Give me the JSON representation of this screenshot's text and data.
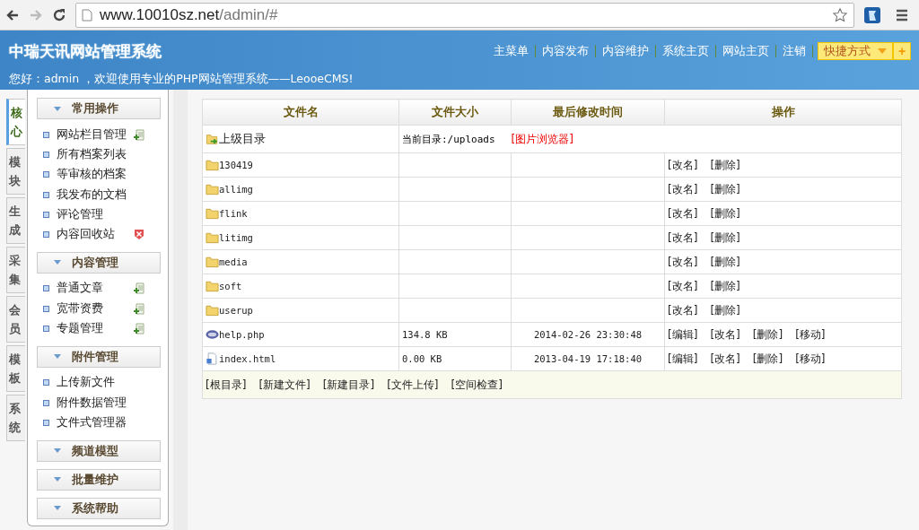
{
  "browser": {
    "url_host": "www.10010sz.net",
    "url_path": "/admin/#"
  },
  "header": {
    "title": "中瑞天讯网站管理系统",
    "welcome": "您好：admin ，欢迎使用专业的PHP网站管理系统——LeooeCMS!",
    "nav": [
      "主菜单",
      "内容发布",
      "内容维护",
      "系统主页",
      "网站主页",
      "注销"
    ],
    "shortcut": {
      "label": "快捷方式",
      "plus": "+"
    }
  },
  "side_tabs": [
    {
      "label": "核心",
      "selected": true
    },
    {
      "label": "模块",
      "selected": false
    },
    {
      "label": "生成",
      "selected": false
    },
    {
      "label": "采集",
      "selected": false
    },
    {
      "label": "会员",
      "selected": false
    },
    {
      "label": "模板",
      "selected": false
    },
    {
      "label": "系统",
      "selected": false
    }
  ],
  "sections": [
    {
      "title": "常用操作",
      "items": [
        {
          "label": "网站栏目管理",
          "kind": "add"
        },
        {
          "label": "所有档案列表",
          "kind": "plain"
        },
        {
          "label": "等审核的档案",
          "kind": "plain"
        },
        {
          "label": "我发布的文档",
          "kind": "plain"
        },
        {
          "label": "评论管理",
          "kind": "plain"
        },
        {
          "label": "内容回收站",
          "kind": "remove"
        }
      ]
    },
    {
      "title": "内容管理",
      "items": [
        {
          "label": "普通文章",
          "kind": "add"
        },
        {
          "label": "宽带资费",
          "kind": "add"
        },
        {
          "label": "专题管理",
          "kind": "add"
        }
      ]
    },
    {
      "title": "附件管理",
      "items": [
        {
          "label": "上传新文件",
          "kind": "plain"
        },
        {
          "label": "附件数据管理",
          "kind": "plain"
        },
        {
          "label": "文件式管理器",
          "kind": "plain"
        }
      ]
    },
    {
      "title": "频道模型"
    },
    {
      "title": "批量维护"
    },
    {
      "title": "系统帮助"
    }
  ],
  "table": {
    "columns": [
      "文件名",
      "文件大小",
      "最后修改时间",
      "操作"
    ],
    "parent": {
      "label": "上级目录",
      "current": "当前目录:/uploads",
      "browser_link": "[图片浏览器]"
    },
    "rows": [
      {
        "kind": "folder",
        "name": "130419",
        "actions": [
          "[改名]",
          "[删除]"
        ]
      },
      {
        "kind": "folder",
        "name": "allimg",
        "actions": [
          "[改名]",
          "[删除]"
        ]
      },
      {
        "kind": "folder",
        "name": "flink",
        "actions": [
          "[改名]",
          "[删除]"
        ]
      },
      {
        "kind": "folder",
        "name": "litimg",
        "actions": [
          "[改名]",
          "[删除]"
        ]
      },
      {
        "kind": "folder",
        "name": "media",
        "actions": [
          "[改名]",
          "[删除]"
        ]
      },
      {
        "kind": "folder",
        "name": "soft",
        "actions": [
          "[改名]",
          "[删除]"
        ]
      },
      {
        "kind": "folder",
        "name": "userup",
        "actions": [
          "[改名]",
          "[删除]"
        ]
      },
      {
        "kind": "php",
        "name": "help.php",
        "size": "134.8 KB",
        "modified": "2014-02-26 23:30:48",
        "actions": [
          "[编辑]",
          "[改名]",
          "[删除]",
          "[移动]"
        ]
      },
      {
        "kind": "html",
        "name": "index.html",
        "size": "0.00 KB",
        "modified": "2013-04-19 17:18:40",
        "actions": [
          "[编辑]",
          "[改名]",
          "[删除]",
          "[移动]"
        ]
      }
    ],
    "footer_links": [
      "[根目录]",
      "[新建文件]",
      "[新建目录]",
      "[文件上传]",
      "[空间检查]"
    ]
  }
}
